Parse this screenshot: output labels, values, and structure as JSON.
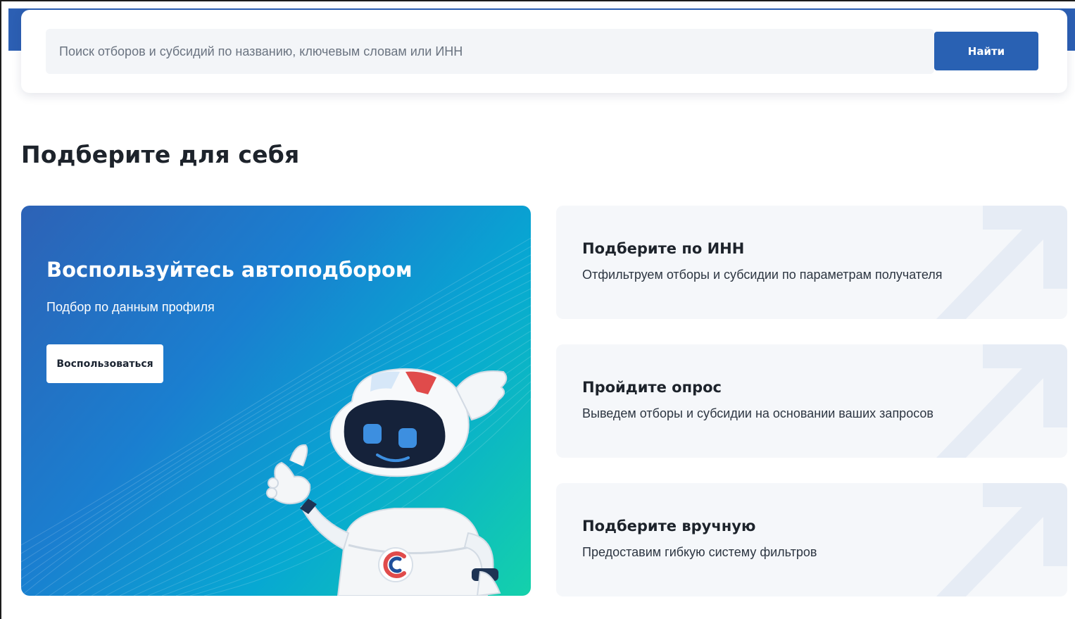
{
  "search": {
    "placeholder": "Поиск отборов и субсидий по названию, ключевым словам или ИНН",
    "value": "",
    "button_label": "Найти"
  },
  "section": {
    "title": "Подберите для себя"
  },
  "hero": {
    "title": "Воспользуйтесь автоподбором",
    "subtitle": "Подбор по данным профиля",
    "button_label": "Воспользоваться",
    "illustration": "robot-mascot"
  },
  "options": [
    {
      "title": "Подберите по ИНН",
      "description": "Отфильтруем отборы и субсидии по параметрам получателя",
      "icon": "arrow-up-right-icon"
    },
    {
      "title": "Пройдите опрос",
      "description": "Выведем отборы и субсидии на основании ваших запросов",
      "icon": "arrow-up-right-icon"
    },
    {
      "title": "Подберите вручную",
      "description": "Предоставим гибкую систему фильтров",
      "icon": "arrow-up-right-icon"
    }
  ],
  "colors": {
    "brand_blue": "#2961b3",
    "gradient_start": "#2d62b6",
    "gradient_end": "#14d1ab",
    "card_background": "#f5f7fa",
    "heading_text": "#1d232b"
  }
}
